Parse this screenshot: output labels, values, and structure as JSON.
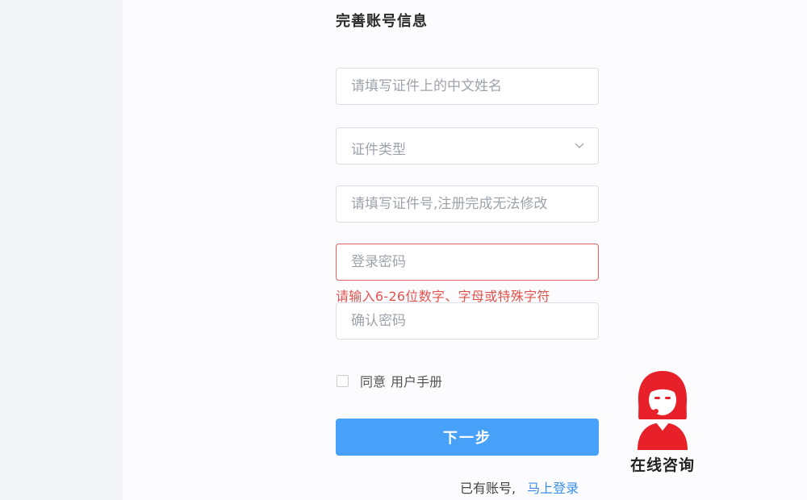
{
  "form": {
    "title": "完善账号信息",
    "name_placeholder": "请填写证件上的中文姓名",
    "id_type_placeholder": "证件类型",
    "id_number_placeholder": "请填写证件号,注册完成无法修改",
    "password_placeholder": "登录密码",
    "password_error": "请输入6-26位数字、字母或特殊字符",
    "confirm_password_placeholder": "确认密码",
    "agree_label": "同意",
    "manual_link": "用户手册",
    "next_button": "下一步",
    "has_account_text": "已有账号,",
    "login_link": "马上登录"
  },
  "support": {
    "label": "在线咨询",
    "icon": "customer-service-agent-icon",
    "color": "#e8202a"
  },
  "colors": {
    "primary": "#47a1f8",
    "link": "#3a8ee6",
    "error": "#e0534d"
  }
}
